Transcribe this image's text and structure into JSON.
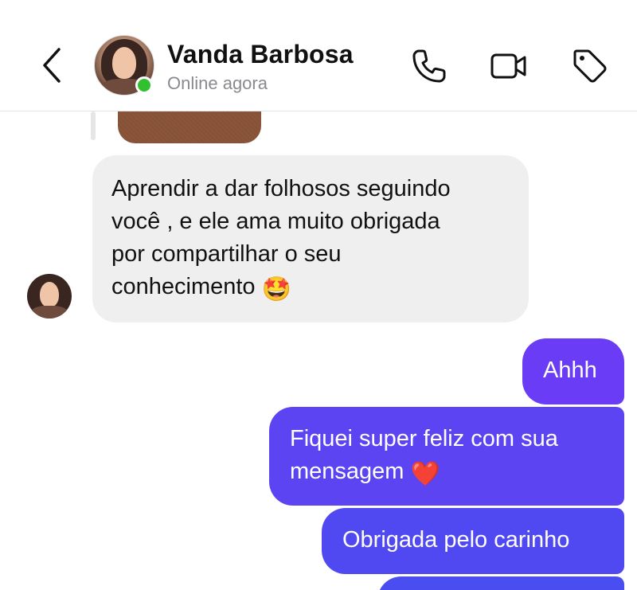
{
  "header": {
    "contact_name": "Vanda Barbosa",
    "status": "Online agora",
    "back_icon": "chevron-left-icon",
    "phone_icon": "phone-icon",
    "video_icon": "video-camera-icon",
    "tag_icon": "tag-icon",
    "online_color": "#31c12f"
  },
  "messages": [
    {
      "direction": "incoming",
      "text": "Aprendir a dar folhosos seguindo\nvocê , e ele ama muito  obrigada\npor compartilhar o seu\nconhecimento",
      "emoji": "🤩"
    },
    {
      "direction": "outgoing",
      "text": "Ahhh",
      "emoji": ""
    },
    {
      "direction": "outgoing",
      "text": "Fiquei super feliz com sua\nmensagem",
      "emoji": "❤️"
    },
    {
      "direction": "outgoing",
      "text": "Obrigada pelo carinho",
      "emoji": ""
    }
  ],
  "colors": {
    "incoming_bubble": "#efefef",
    "outgoing_bubble_top": "#6a3cf5",
    "outgoing_bubble_bottom": "#4a4ef0"
  }
}
